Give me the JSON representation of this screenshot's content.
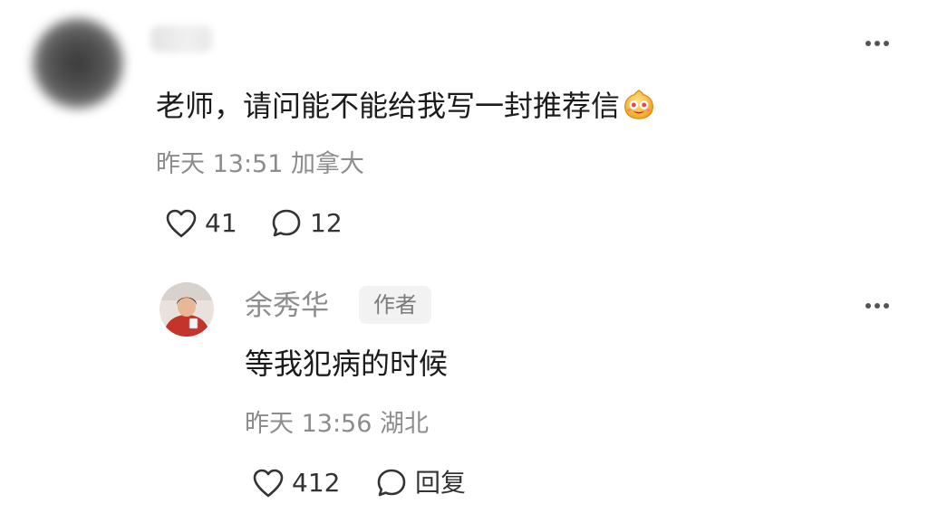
{
  "comment": {
    "text": "老师，请问能不能给我写一封推荐信",
    "emoji": "grin-emoji",
    "meta": "昨天 13:51 加拿大",
    "likes": "41",
    "replies": "12"
  },
  "reply": {
    "author": "余秀华",
    "badge": "作者",
    "text": "等我犯病的时候",
    "meta": "昨天 13:56 湖北",
    "likes": "412",
    "reply_label": "回复"
  },
  "colors": {
    "text_primary": "#1b1b1b",
    "text_secondary": "#8c8c8c",
    "icon": "#333333",
    "badge_bg": "#f2f2f2"
  }
}
